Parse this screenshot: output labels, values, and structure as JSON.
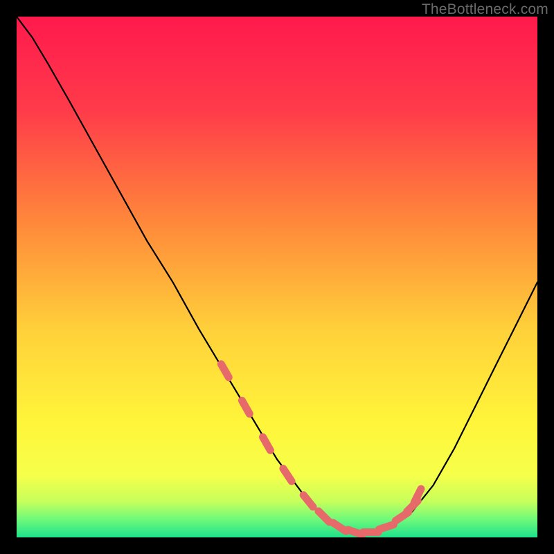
{
  "watermark": {
    "text": "TheBottleneck.com"
  },
  "colors": {
    "gradient_stops": [
      {
        "offset": 0.0,
        "color": "#ff1a4d"
      },
      {
        "offset": 0.18,
        "color": "#ff3b4a"
      },
      {
        "offset": 0.4,
        "color": "#ff8a3a"
      },
      {
        "offset": 0.6,
        "color": "#ffd03a"
      },
      {
        "offset": 0.78,
        "color": "#fff53a"
      },
      {
        "offset": 0.88,
        "color": "#f6ff4a"
      },
      {
        "offset": 0.93,
        "color": "#c8ff5a"
      },
      {
        "offset": 0.965,
        "color": "#70f97a"
      },
      {
        "offset": 1.0,
        "color": "#1de28c"
      }
    ],
    "curve": "#000000",
    "marker_fill": "#e66a6a",
    "marker_stroke": "#d85a5a"
  },
  "chart_data": {
    "type": "line",
    "title": "",
    "xlabel": "",
    "ylabel": "",
    "xlim": [
      0,
      100
    ],
    "ylim": [
      0,
      100
    ],
    "series": [
      {
        "name": "bottleneck-curve",
        "x": [
          0,
          3,
          6,
          10,
          15,
          20,
          25,
          30,
          35,
          38,
          41,
          44,
          47,
          50,
          53,
          56,
          59,
          62,
          65,
          68,
          72,
          76,
          80,
          84,
          88,
          92,
          96,
          100
        ],
        "y": [
          100,
          96,
          91,
          84,
          75,
          66,
          57,
          49,
          40,
          35,
          30,
          25,
          20,
          15,
          11,
          7,
          4,
          2,
          1,
          1,
          2,
          5,
          10,
          17,
          25,
          33,
          41,
          49
        ]
      }
    ],
    "markers": {
      "name": "highlight-points",
      "x": [
        40,
        44,
        48,
        52,
        56,
        59,
        62,
        65,
        68,
        71,
        74,
        76,
        77
      ],
      "y": [
        32,
        25,
        18,
        12,
        7,
        4,
        2,
        1,
        1,
        2,
        4,
        6,
        8
      ]
    }
  }
}
